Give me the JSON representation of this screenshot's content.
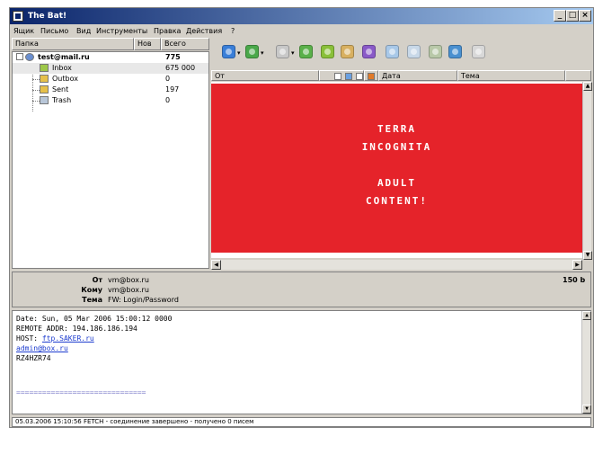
{
  "window": {
    "title": "The Bat!",
    "controls": [
      "_",
      "□",
      "×"
    ]
  },
  "menu": [
    "Ящик",
    "Письмо",
    "Вид",
    "Инструменты",
    "Правка",
    "Действия",
    "?"
  ],
  "folder_pane": {
    "col_folder": "Папка",
    "col_new": "Нов",
    "col_total": "Всего",
    "account": {
      "name": "test@mail.ru",
      "total": "775"
    },
    "folders": [
      {
        "name": "Inbox",
        "total": "675 000"
      },
      {
        "name": "Outbox",
        "total": "0"
      },
      {
        "name": "Sent",
        "total": "197"
      },
      {
        "name": "Trash",
        "total": "0"
      }
    ]
  },
  "toolbar": {
    "icons": [
      "get-mail-icon",
      "send-mail-icon",
      "new-message-icon",
      "reply-icon",
      "reply-all-icon",
      "forward-icon",
      "redirect-icon",
      "delete-icon",
      "print-icon",
      "address-book-icon",
      "find-icon",
      "filter-icon"
    ]
  },
  "message_list": {
    "col_from": "От",
    "col_date": "Дата",
    "col_subject": "Тема"
  },
  "preview": {
    "lines": [
      "TERRA",
      "INCOGNITA",
      "ADULT",
      "CONTENT!"
    ],
    "background": "#e5232a"
  },
  "header_panel": {
    "from_label": "От",
    "from_value": "vm@box.ru",
    "to_label": "Кому",
    "to_value": "vm@box.ru",
    "subject_label": "Тема",
    "subject_value": "FW: Login/Password",
    "size": "150 b"
  },
  "body": {
    "line1": "Date: Sun, 05 Mar 2006 15:00:12 0000",
    "line2": "REMOTE ADDR: 194.186.186.194",
    "line3_prefix": "HOST: ",
    "line3_link": "ftp.SAKER.ru",
    "line4": "admin@box.ru",
    "line5": "RZ4HZR74",
    "separator": "=============================="
  },
  "statusbar": {
    "text": "05.03.2006 15:10:56 FETCH - соединение завершено - получено 0 писем"
  }
}
